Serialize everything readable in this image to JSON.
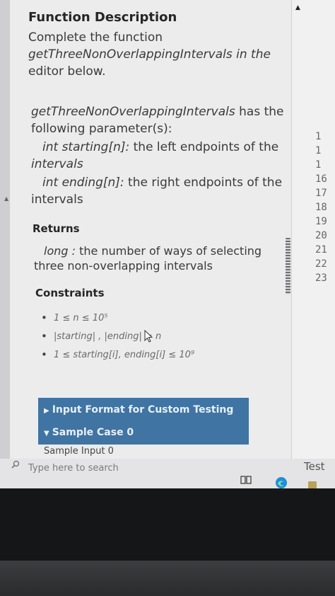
{
  "problem": {
    "function_description_heading": "Function Description",
    "desc_line1": "Complete the function",
    "desc_line2": "getThreeNonOverlappingIntervals in the",
    "desc_line3": "editor below.",
    "params_fn": "getThreeNonOverlappingIntervals",
    "params_rest": " has the",
    "params_line2": "following parameter(s):",
    "param1_signature": "int starting[n]:",
    "param1_text": " the left endpoints of the",
    "param1_cont": "intervals",
    "param2_signature": "int ending[n]:",
    "param2_text": " the right endpoints of the",
    "param2_cont": "intervals",
    "returns_heading": "Returns",
    "returns_type": "long :",
    "returns_text": " the number of ways of selecting",
    "returns_cont": "three non-overlapping intervals",
    "constraints_heading": "Constraints",
    "constraints": [
      "1 ≤ n ≤ 10⁵",
      "|starting| , |ending| = n",
      "1 ≤ starting[i], ending[i] ≤ 10⁹"
    ]
  },
  "sections": {
    "input_format_label": "Input Format for Custom Testing",
    "sample_case_label": "Sample Case 0",
    "sample_input_label": "Sample Input 0"
  },
  "editor": {
    "line_numbers": [
      "1",
      "1",
      "1",
      "16",
      "17",
      "18",
      "19",
      "20",
      "21",
      "22",
      "23"
    ]
  },
  "taskbar": {
    "search_placeholder": "Type here to search",
    "test_label": "Test"
  },
  "icons": {
    "search": "search-icon",
    "task_view": "task-view-icon",
    "browser": "edge-browser-icon",
    "folder": "folder-icon",
    "cursor": "mouse-cursor-icon"
  },
  "colors": {
    "section_bar": "#3f74a3",
    "panel_bg": "#ececed",
    "text": "#3a3a3a"
  }
}
